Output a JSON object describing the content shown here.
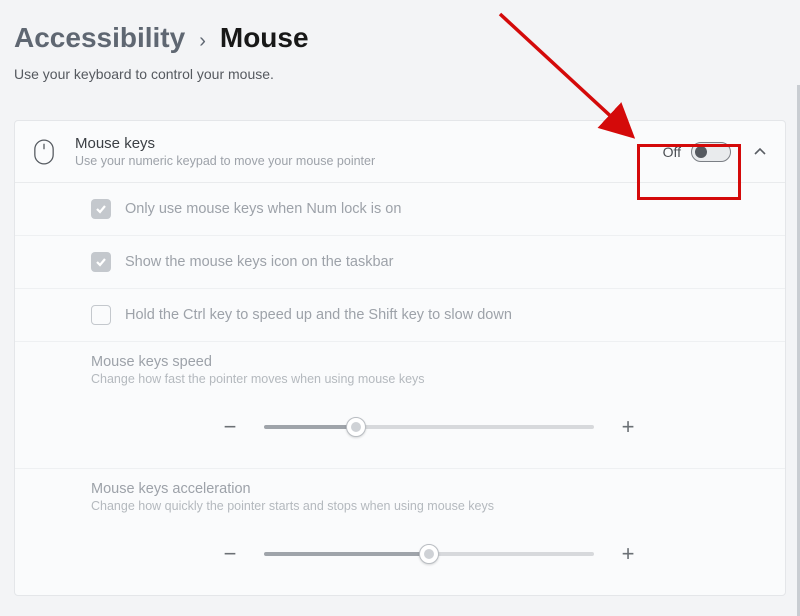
{
  "breadcrumb": {
    "parent": "Accessibility",
    "current": "Mouse"
  },
  "subtitle": "Use your keyboard to control your mouse.",
  "mouseKeys": {
    "title": "Mouse keys",
    "description": "Use your numeric keypad to move your mouse pointer",
    "toggle": {
      "label": "Off",
      "on": false
    }
  },
  "options": {
    "numlock": {
      "label": "Only use mouse keys when Num lock is on",
      "checked": true
    },
    "taskbar": {
      "label": "Show the mouse keys icon on the taskbar",
      "checked": true
    },
    "ctrlshift": {
      "label": "Hold the Ctrl key to speed up and the Shift key to slow down",
      "checked": false
    }
  },
  "sliders": {
    "speed": {
      "title": "Mouse keys speed",
      "description": "Change how fast the pointer moves when using mouse keys",
      "minus": "−",
      "plus": "+",
      "valuePercent": 28
    },
    "accel": {
      "title": "Mouse keys acceleration",
      "description": "Change how quickly the pointer starts and stops when using mouse keys",
      "minus": "−",
      "plus": "+",
      "valuePercent": 50
    }
  },
  "annotation": {
    "arrowColor": "#d40a0a"
  }
}
